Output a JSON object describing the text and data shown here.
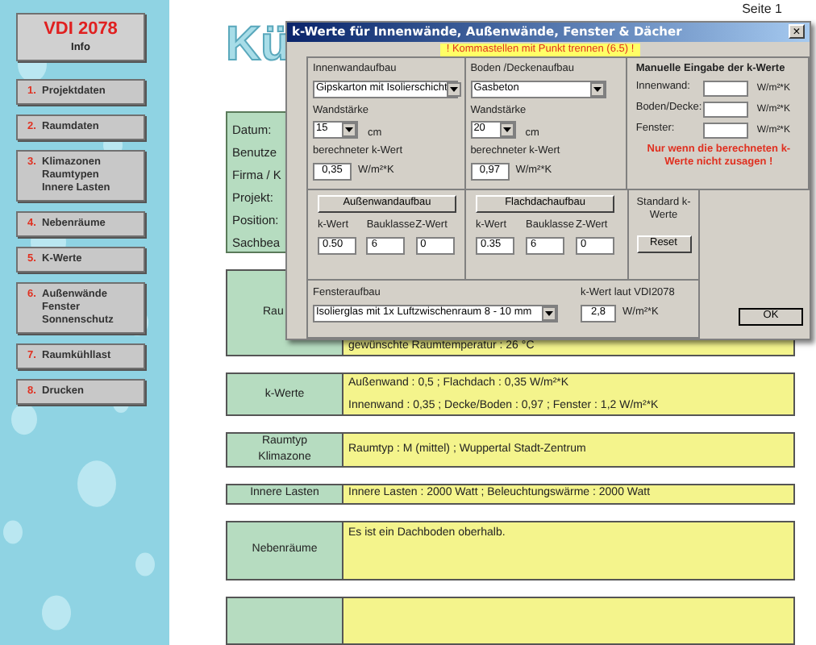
{
  "sidebar": {
    "info": {
      "title": "VDI 2078",
      "subtitle": "Info"
    },
    "items": [
      {
        "number": "1.",
        "lines": [
          "Projektdaten"
        ]
      },
      {
        "number": "2.",
        "lines": [
          "Raumdaten"
        ]
      },
      {
        "number": "3.",
        "lines": [
          "Klimazonen",
          "Raumtypen",
          "Innere Lasten"
        ]
      },
      {
        "number": "4.",
        "lines": [
          "Nebenräume"
        ]
      },
      {
        "number": "5.",
        "lines": [
          "K-Werte"
        ]
      },
      {
        "number": "6.",
        "lines": [
          "Außenwände",
          "Fenster",
          "Sonnenschutz"
        ]
      },
      {
        "number": "7.",
        "lines": [
          "Raumkühllast"
        ]
      },
      {
        "number": "8.",
        "lines": [
          "Drucken"
        ]
      }
    ]
  },
  "page": {
    "page_number": "Seite 1",
    "title": "Kü",
    "project_labels": [
      "Datum:",
      "Benutze",
      "Firma / K",
      "Projekt:",
      "Position:",
      "Sachbea"
    ],
    "rows": [
      {
        "label": [
          "Rau"
        ],
        "values": [
          "gewünschte Raumtemperatur : 26 °C"
        ]
      },
      {
        "label": [
          "k-Werte"
        ],
        "values": [
          "Außenwand : 0,5 ; Flachdach : 0,35 W/m²*K",
          "Innenwand : 0,35 ; Decke/Boden : 0,97 ; Fenster : 1,2  W/m²*K"
        ]
      },
      {
        "label": [
          "Raumtyp",
          "Klimazone"
        ],
        "values": [
          "Raumtyp : M (mittel)  ;  Wuppertal Stadt-Zentrum"
        ]
      },
      {
        "label": [
          "Innere Lasten"
        ],
        "values": [
          "Innere Lasten : 2000 Watt  ;  Beleuchtungswärme : 2000 Watt"
        ]
      },
      {
        "label": [
          "Nebenräume"
        ],
        "values": [
          "Es ist ein Dachboden oberhalb."
        ]
      }
    ]
  },
  "dialog": {
    "title": "k-Werte für Innenwände, Außenwände, Fenster & Dächer",
    "close": "×",
    "banner": "! Kommastellen mit Punkt trennen (6.5) !",
    "walls": [
      {
        "heading": "Innenwandaufbau",
        "material": "Gipskarton mit Isolierschicht",
        "thickness_label": "Wandstärke",
        "thickness": "15",
        "unit": "cm",
        "k_label": "berechneter k-Wert",
        "k": "0,35",
        "k_unit": "W/m²*K"
      },
      {
        "heading": "Boden /Deckenaufbau",
        "material": "Gasbeton",
        "thickness_label": "Wandstärke",
        "thickness": "20",
        "unit": "cm",
        "k_label": "berechneter k-Wert",
        "k": "0,97",
        "k_unit": "W/m²*K"
      }
    ],
    "manual": {
      "heading": "Manuelle Eingabe der k-Werte",
      "fields": [
        {
          "label": "Innenwand:",
          "unit": "W/m²*K"
        },
        {
          "label": "Boden/Decke:",
          "unit": "W/m²*K"
        },
        {
          "label": "Fenster:",
          "unit": "W/m²*K"
        }
      ],
      "note": "Nur wenn die berechneten k- Werte nicht zusagen !"
    },
    "builds": [
      {
        "button": "Außenwandaufbau",
        "columns": [
          "k-Wert",
          "Bauklasse",
          "Z-Wert"
        ],
        "values": [
          "0.50",
          "6",
          "0"
        ]
      },
      {
        "button": "Flachdachaufbau",
        "columns": [
          "k-Wert",
          "Bauklasse",
          "Z-Wert"
        ],
        "values": [
          "0.35",
          "6",
          "0"
        ]
      }
    ],
    "standard": {
      "label": "Standard k-Werte",
      "button": "Reset"
    },
    "window": {
      "heading": "Fensteraufbau",
      "glass": "Isolierglas mit 1x Luftzwischenraum 8 -  10 mm",
      "k_label": "k-Wert laut VDI2078",
      "k": "2,8",
      "k_unit": "W/m²*K"
    },
    "ok": "OK"
  }
}
